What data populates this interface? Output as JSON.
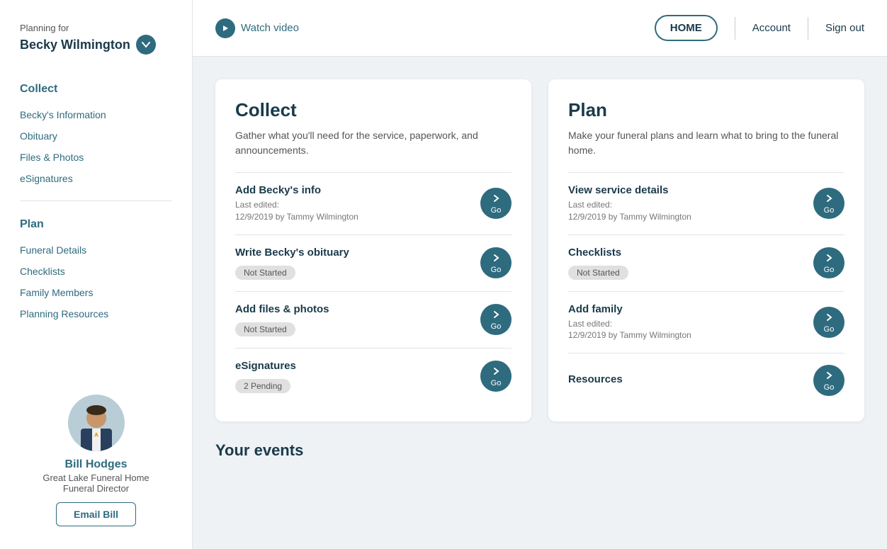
{
  "sidebar": {
    "planning_for": "Planning for",
    "name": "Becky Wilmington",
    "collect_label": "Collect",
    "collect_items": [
      {
        "label": "Becky's Information",
        "key": "beckys-info"
      },
      {
        "label": "Obituary",
        "key": "obituary"
      },
      {
        "label": "Files & Photos",
        "key": "files-photos"
      },
      {
        "label": "eSignatures",
        "key": "esignatures"
      }
    ],
    "plan_label": "Plan",
    "plan_items": [
      {
        "label": "Funeral Details",
        "key": "funeral-details"
      },
      {
        "label": "Checklists",
        "key": "checklists"
      },
      {
        "label": "Family Members",
        "key": "family-members"
      },
      {
        "label": "Planning Resources",
        "key": "planning-resources"
      }
    ],
    "agent": {
      "name": "Bill Hodges",
      "company": "Great Lake Funeral Home",
      "role": "Funeral Director",
      "email_btn": "Email Bill"
    }
  },
  "topnav": {
    "watch_video": "Watch video",
    "home_btn": "HOME",
    "account_link": "Account",
    "signout_link": "Sign out"
  },
  "collect_card": {
    "title": "Collect",
    "description": "Gather what you'll need for the service, paperwork, and announcements.",
    "items": [
      {
        "title": "Add Becky's info",
        "meta": "Last edited:\n12/9/2019 by Tammy Wilmington",
        "badge": null,
        "go_label": "Go"
      },
      {
        "title": "Write Becky's obituary",
        "meta": null,
        "badge": "Not Started",
        "go_label": "Go"
      },
      {
        "title": "Add files & photos",
        "meta": null,
        "badge": "Not Started",
        "go_label": "Go"
      },
      {
        "title": "eSignatures",
        "meta": null,
        "badge": "2 Pending",
        "go_label": "Go"
      }
    ]
  },
  "plan_card": {
    "title": "Plan",
    "description": "Make your funeral plans and learn what to bring to the funeral home.",
    "items": [
      {
        "title": "View service details",
        "meta": "Last edited:\n12/9/2019 by Tammy Wilmington",
        "badge": null,
        "go_label": "Go"
      },
      {
        "title": "Checklists",
        "meta": null,
        "badge": "Not Started",
        "go_label": "Go"
      },
      {
        "title": "Add family",
        "meta": "Last edited:\n12/9/2019 by Tammy Wilmington",
        "badge": null,
        "go_label": "Go"
      },
      {
        "title": "Resources",
        "meta": null,
        "badge": null,
        "go_label": "Go"
      }
    ]
  },
  "events_section": {
    "title": "Your events"
  }
}
